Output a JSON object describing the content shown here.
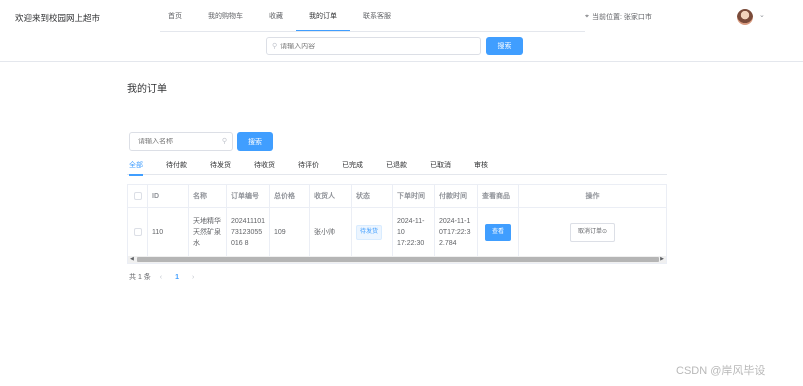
{
  "header": {
    "brand": "欢迎来到校园网上超市",
    "nav": [
      "首页",
      "我的购物车",
      "收藏",
      "我的订单",
      "联系客服"
    ],
    "active_nav": "我的订单",
    "location_label": "当前位置: 张家口市",
    "search_placeholder": "请输入内容",
    "search_button": "搜索"
  },
  "page": {
    "title": "我的订单",
    "search_placeholder": "请输入名称",
    "search_button": "搜索"
  },
  "tabs": [
    "全部",
    "待付款",
    "待发货",
    "待收货",
    "待评价",
    "已完成",
    "已退款",
    "已取消",
    "审核"
  ],
  "active_tab": "全部",
  "table": {
    "columns": [
      "ID",
      "名称",
      "订单编号",
      "总价格",
      "收货人",
      "状态",
      "下单时间",
      "付款时间",
      "查看商品",
      "操作"
    ],
    "rows": [
      {
        "id": "110",
        "name": "天地精华天然矿泉水",
        "order_no": "20241110173123055016 8",
        "total": "109",
        "receiver": "张小帅",
        "status": "待发货",
        "order_time": "2024-11-10 17:22:30",
        "pay_time": "2024-11-10T17:22:32.784",
        "view_label": "查看",
        "action_label": "取消订单⊙"
      }
    ]
  },
  "pagination": {
    "total_label": "共 1 条",
    "prev": "‹",
    "current_page": "1",
    "next": "›"
  },
  "watermark": "CSDN @岸风毕设",
  "colors": {
    "primary": "#409eff",
    "border": "#ebeef5",
    "text": "#303133",
    "muted": "#909399"
  }
}
